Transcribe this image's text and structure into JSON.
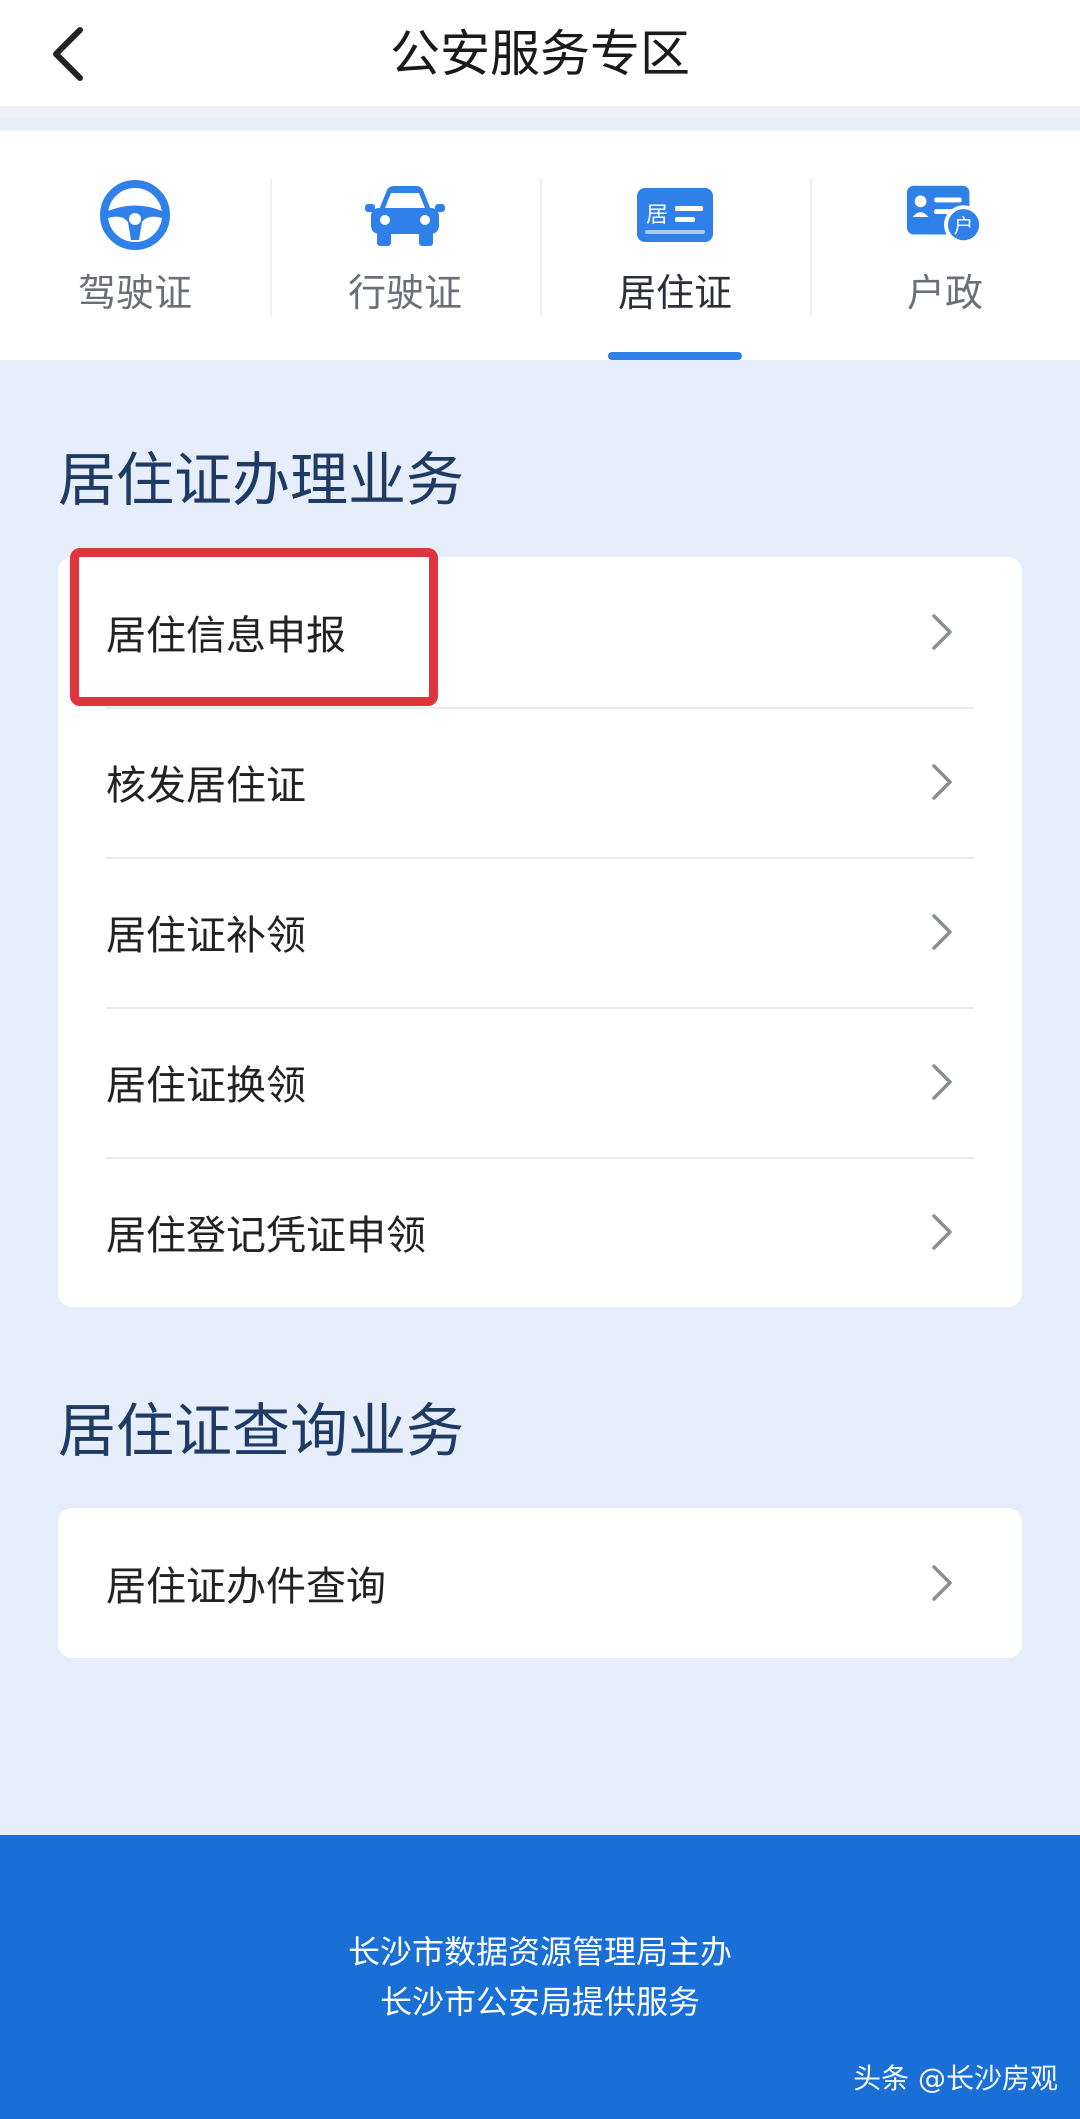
{
  "header": {
    "title": "公安服务专区",
    "back_icon": "chevron-left-icon"
  },
  "tabs": [
    {
      "label": "驾驶证",
      "icon": "steering-wheel-icon",
      "active": false
    },
    {
      "label": "行驶证",
      "icon": "car-icon",
      "active": false
    },
    {
      "label": "居住证",
      "icon": "residence-card-icon",
      "icon_text": "居",
      "active": true
    },
    {
      "label": "户政",
      "icon": "household-card-icon",
      "icon_text": "户",
      "active": false
    }
  ],
  "sections": [
    {
      "title": "居住证办理业务",
      "items": [
        {
          "label": "居住信息申报"
        },
        {
          "label": "核发居住证"
        },
        {
          "label": "居住证补领"
        },
        {
          "label": "居住证换领"
        },
        {
          "label": "居住登记凭证申领"
        }
      ]
    },
    {
      "title": "居住证查询业务",
      "items": [
        {
          "label": "居住证办件查询"
        }
      ]
    }
  ],
  "footer": {
    "line1": "长沙市数据资源管理局主办",
    "line2": "长沙市公安局提供服务"
  },
  "watermark": "头条 @长沙房观",
  "colors": {
    "accent": "#2f80e8",
    "footer_bg": "#1a6fd6",
    "page_bg": "#e6edfb",
    "section_title": "#1f3a63",
    "highlight": "#e0343f"
  }
}
